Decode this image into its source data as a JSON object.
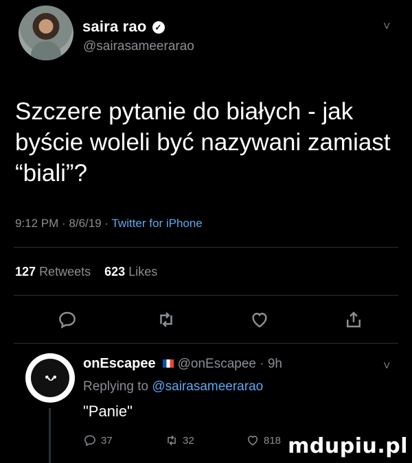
{
  "tweet": {
    "author_name": "saira rao",
    "author_handle": "@sairasameerarao",
    "text": "Szczere pytanie do białych - jak byście woleli być nazywani zamiast “biali”?",
    "time": "9:12 PM · 8/6/19 · ",
    "source": "Twitter for iPhone",
    "retweets_count": "127",
    "retweets_label": "Retweets",
    "likes_count": "623",
    "likes_label": "Likes"
  },
  "reply": {
    "author_name": "onEscapee",
    "author_handle": "@onEscapee · 9h",
    "replying_prefix": "Replying to ",
    "replying_to": "@sairasameerarao",
    "text": "\"Panie\"",
    "replies": "37",
    "retweets": "32",
    "likes": "818"
  },
  "icons": {
    "chevron": "˅"
  },
  "watermark": "mdupiu.pl",
  "colors": {
    "background": "#000000",
    "link": "#5fa8f0",
    "muted": "#8a8f94"
  }
}
